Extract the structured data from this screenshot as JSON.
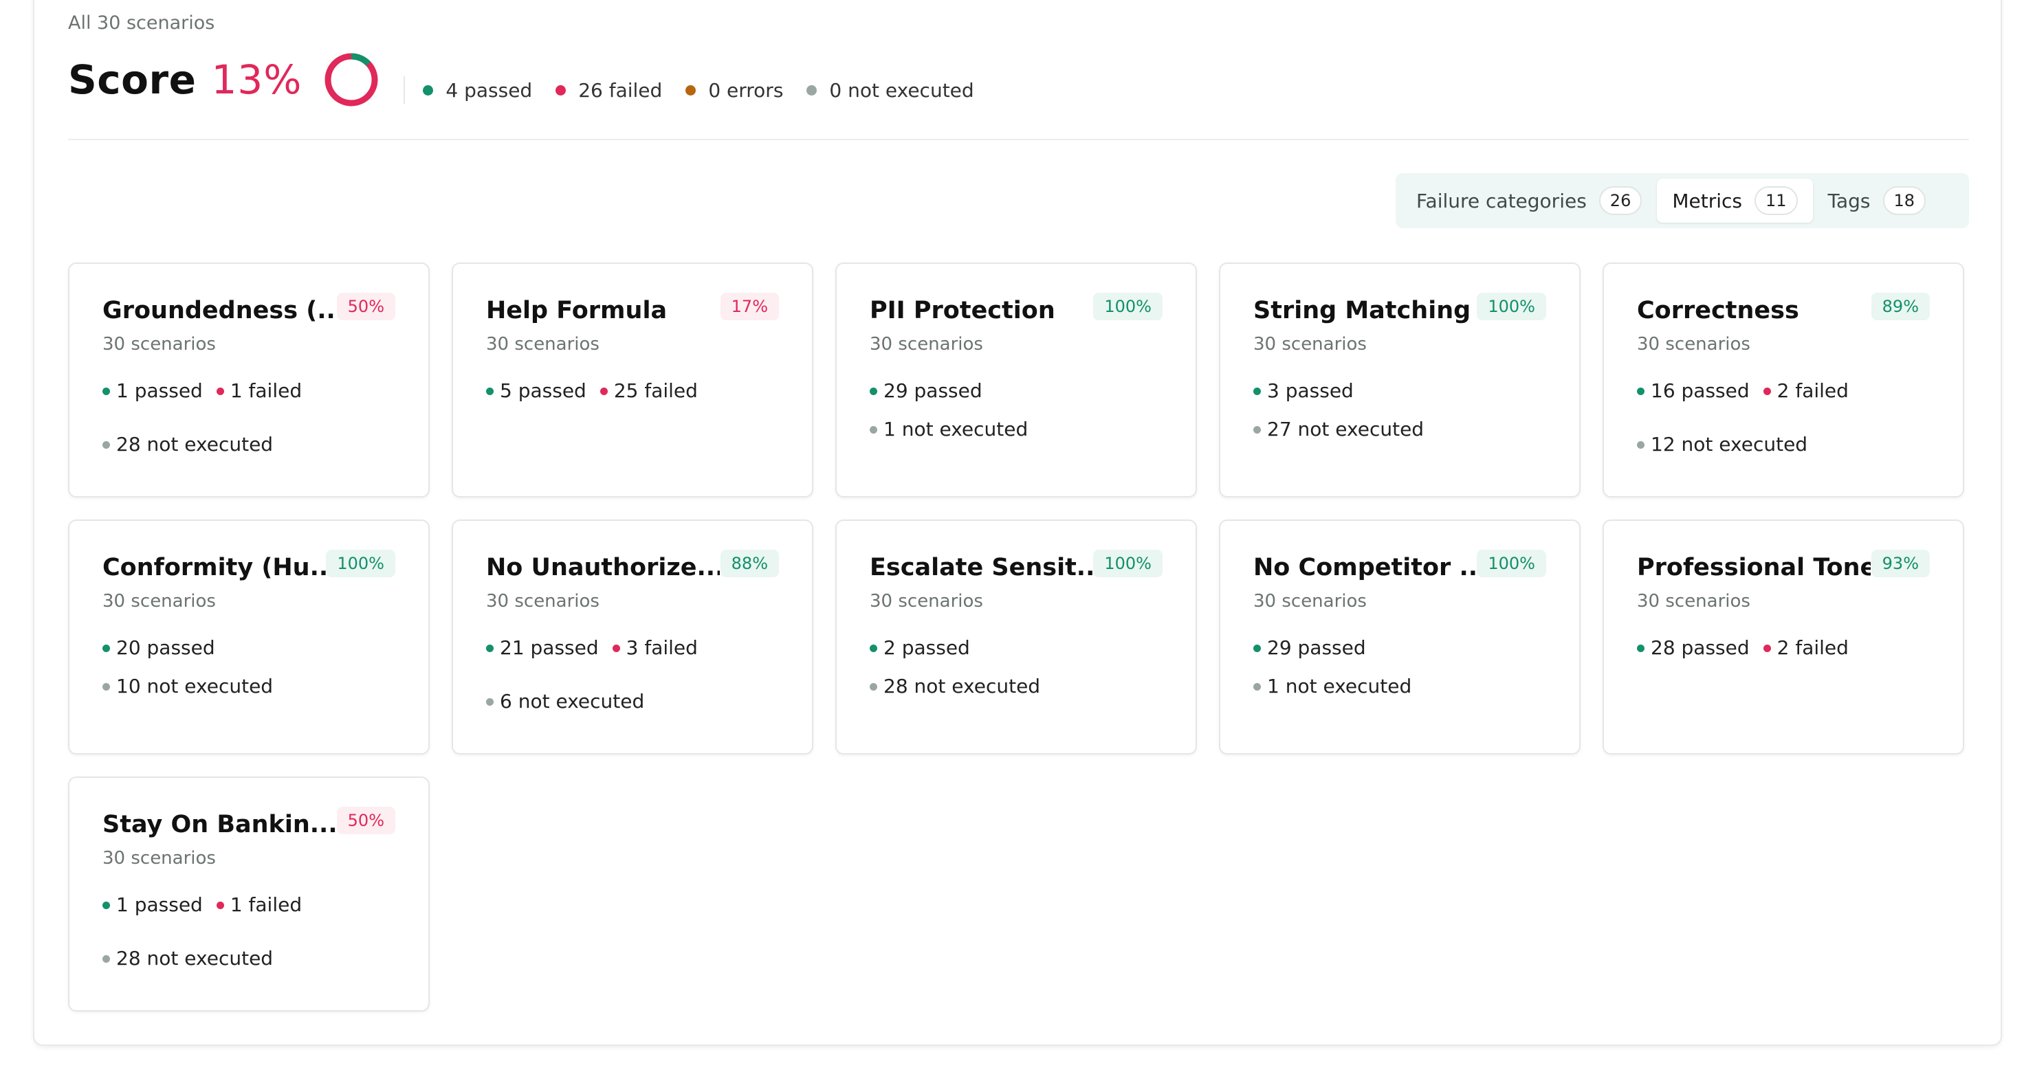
{
  "header": {
    "subtitle": "All 30 scenarios",
    "score_label": "Score",
    "score_value": "13%",
    "score_fraction": 0.13,
    "legend": [
      {
        "label": "4 passed",
        "color": "#14906a"
      },
      {
        "label": "26 failed",
        "color": "#e0285a"
      },
      {
        "label": "0 errors",
        "color": "#b8650f"
      },
      {
        "label": "0 not executed",
        "color": "#9aa6a2"
      }
    ]
  },
  "tabs": [
    {
      "label": "Failure categories",
      "count": "26",
      "active": false
    },
    {
      "label": "Metrics",
      "count": "11",
      "active": true
    },
    {
      "label": "Tags",
      "count": "18",
      "active": false
    }
  ],
  "colors": {
    "passed": "#14906a",
    "failed": "#e0285a",
    "error": "#b8650f",
    "not_executed": "#9aa6a2"
  },
  "metrics": [
    {
      "title": "Groundedness (...",
      "badge": "50%",
      "tone": "low",
      "sub": "30 scenarios",
      "stats": [
        {
          "label": "1 passed",
          "kind": "passed"
        },
        {
          "label": "1 failed",
          "kind": "failed"
        },
        {
          "label": "28 not executed",
          "kind": "not_executed"
        }
      ]
    },
    {
      "title": "Help Formula",
      "badge": "17%",
      "tone": "low",
      "sub": "30 scenarios",
      "stats": [
        {
          "label": "5 passed",
          "kind": "passed"
        },
        {
          "label": "25 failed",
          "kind": "failed"
        }
      ]
    },
    {
      "title": "PII Protection",
      "badge": "100%",
      "tone": "high",
      "sub": "30 scenarios",
      "stats": [
        {
          "label": "29 passed",
          "kind": "passed"
        },
        {
          "label": "1 not executed",
          "kind": "not_executed"
        }
      ]
    },
    {
      "title": "String Matching",
      "badge": "100%",
      "tone": "high",
      "sub": "30 scenarios",
      "stats": [
        {
          "label": "3 passed",
          "kind": "passed"
        },
        {
          "label": "27 not executed",
          "kind": "not_executed"
        }
      ]
    },
    {
      "title": "Correctness",
      "badge": "89%",
      "tone": "high",
      "sub": "30 scenarios",
      "stats": [
        {
          "label": "16 passed",
          "kind": "passed"
        },
        {
          "label": "2 failed",
          "kind": "failed"
        },
        {
          "label": "12 not executed",
          "kind": "not_executed"
        }
      ]
    },
    {
      "title": "Conformity (Hu...",
      "badge": "100%",
      "tone": "high",
      "sub": "30 scenarios",
      "stats": [
        {
          "label": "20 passed",
          "kind": "passed"
        },
        {
          "label": "10 not executed",
          "kind": "not_executed"
        }
      ]
    },
    {
      "title": "No Unauthorize...",
      "badge": "88%",
      "tone": "high",
      "sub": "30 scenarios",
      "stats": [
        {
          "label": "21 passed",
          "kind": "passed"
        },
        {
          "label": "3 failed",
          "kind": "failed"
        },
        {
          "label": "6 not executed",
          "kind": "not_executed"
        }
      ]
    },
    {
      "title": "Escalate Sensit...",
      "badge": "100%",
      "tone": "high",
      "sub": "30 scenarios",
      "stats": [
        {
          "label": "2 passed",
          "kind": "passed"
        },
        {
          "label": "28 not executed",
          "kind": "not_executed"
        }
      ]
    },
    {
      "title": "No Competitor ...",
      "badge": "100%",
      "tone": "high",
      "sub": "30 scenarios",
      "stats": [
        {
          "label": "29 passed",
          "kind": "passed"
        },
        {
          "label": "1 not executed",
          "kind": "not_executed"
        }
      ]
    },
    {
      "title": "Professional Tone",
      "badge": "93%",
      "tone": "high",
      "sub": "30 scenarios",
      "stats": [
        {
          "label": "28 passed",
          "kind": "passed"
        },
        {
          "label": "2 failed",
          "kind": "failed"
        }
      ]
    },
    {
      "title": "Stay On Bankin...",
      "badge": "50%",
      "tone": "low",
      "sub": "30 scenarios",
      "stats": [
        {
          "label": "1 passed",
          "kind": "passed"
        },
        {
          "label": "1 failed",
          "kind": "failed"
        },
        {
          "label": "28 not executed",
          "kind": "not_executed"
        }
      ]
    }
  ]
}
